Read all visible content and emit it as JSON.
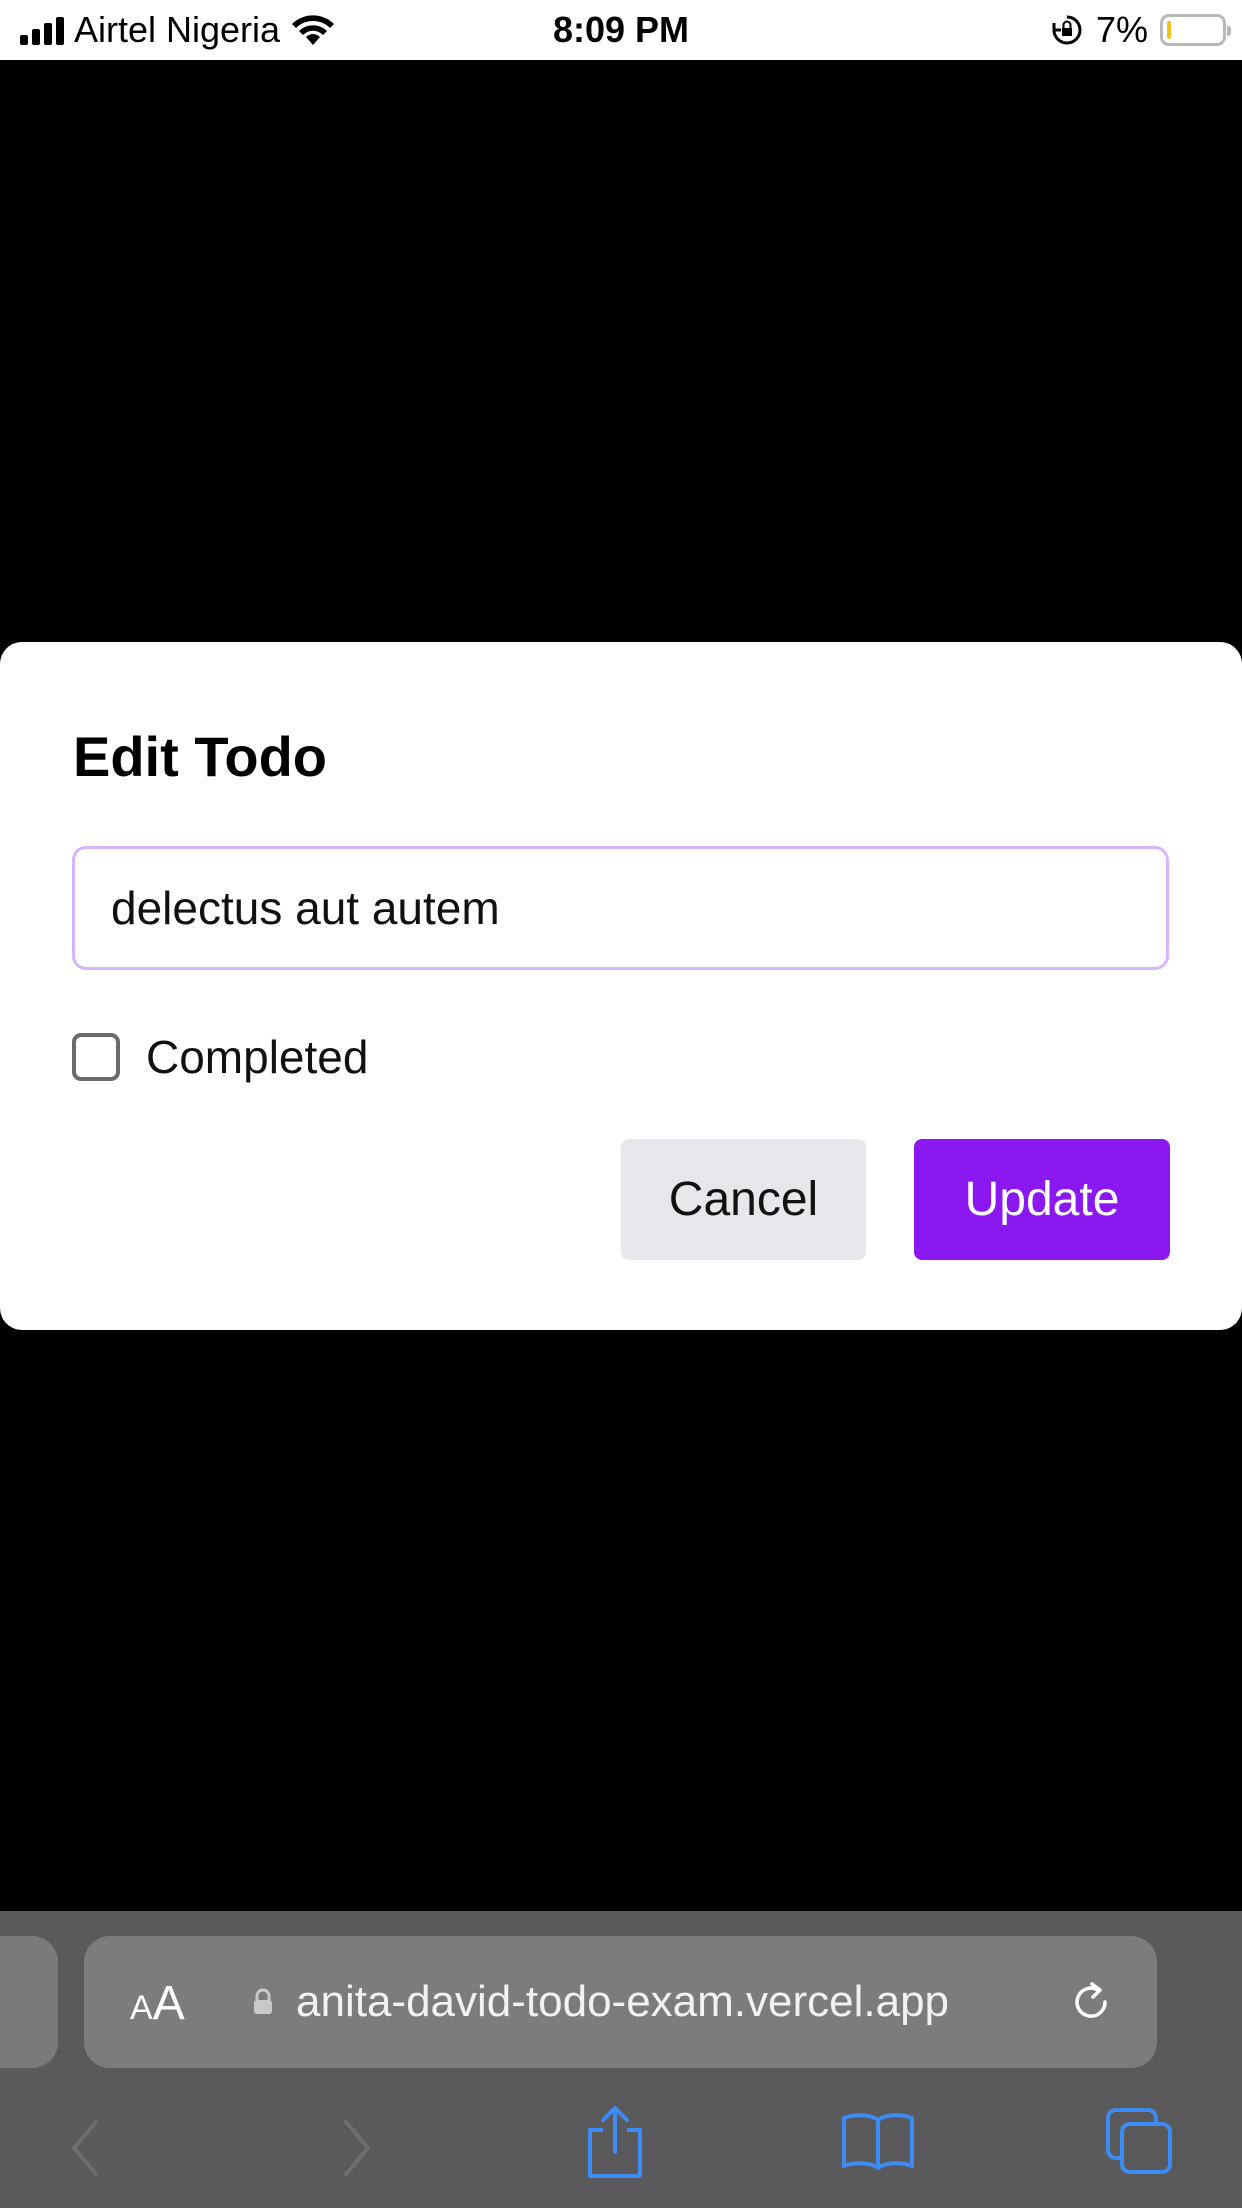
{
  "status_bar": {
    "carrier": "Airtel Nigeria",
    "time": "8:09 PM",
    "battery_percent": "7%",
    "battery_level": 0.07,
    "battery_color": "#f2c21b"
  },
  "modal": {
    "title": "Edit Todo",
    "input_value": "delectus aut autem",
    "input_border_color": "#d8b4fe",
    "checkbox_label": "Completed",
    "checkbox_checked": false,
    "cancel_label": "Cancel",
    "update_label": "Update",
    "accent_color": "#8b18f0"
  },
  "browser": {
    "text_size_label_small": "A",
    "text_size_label_large": "A",
    "url": "anita-david-todo-exam.vercel.app",
    "icons": [
      "lock-icon",
      "reload-icon",
      "back-icon",
      "forward-icon",
      "share-icon",
      "bookmarks-icon",
      "tabs-icon"
    ]
  }
}
